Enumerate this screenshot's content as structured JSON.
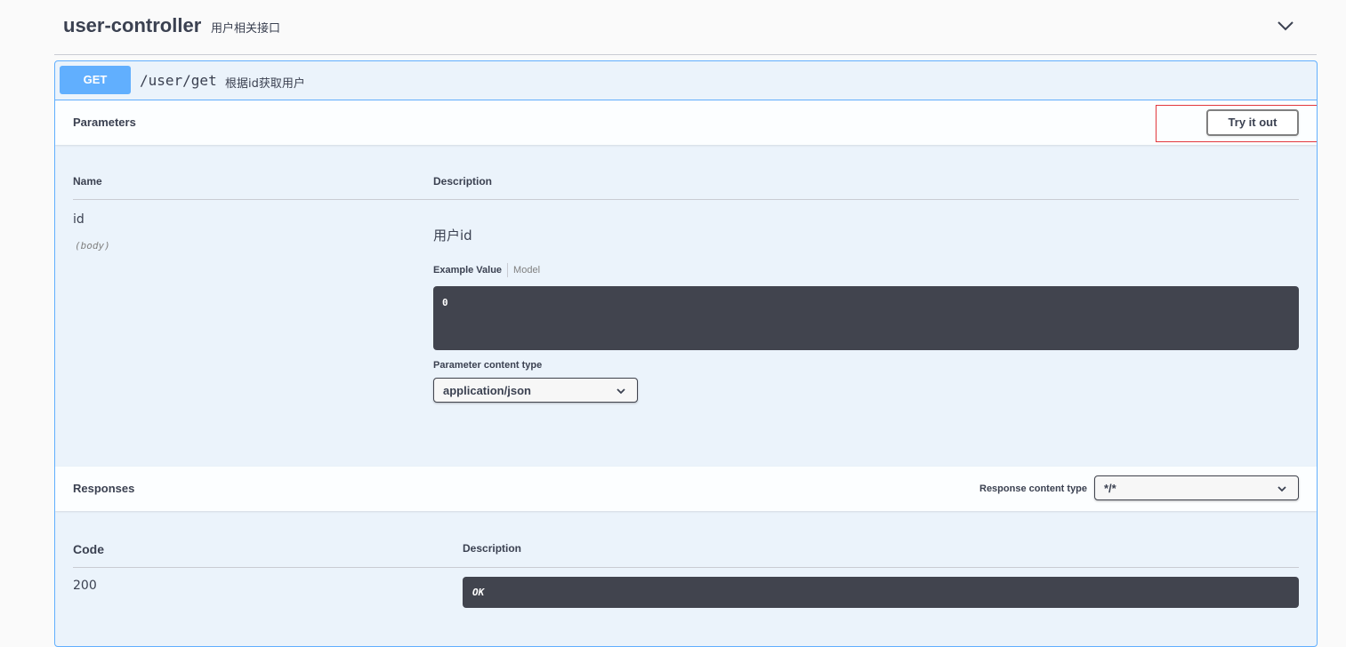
{
  "tag": {
    "name": "user-controller",
    "description": "用户相关接口",
    "chevron_icon": "chevron-down-icon"
  },
  "operation": {
    "method": "GET",
    "path": "/user/get",
    "summary": "根据id获取用户",
    "color": "#61affe"
  },
  "parameters": {
    "title": "Parameters",
    "try_label": "Try it out",
    "columns": {
      "name": "Name",
      "description": "Description"
    },
    "items": [
      {
        "name": "id",
        "in": "(body)",
        "description": "用户id",
        "tabs": {
          "active": "Example Value",
          "inactive": "Model"
        },
        "example": "0"
      }
    ],
    "content_type_label": "Parameter content type",
    "content_type_value": "application/json"
  },
  "responses": {
    "title": "Responses",
    "content_type_label": "Response content type",
    "content_type_value": "*/*",
    "columns": {
      "code": "Code",
      "description": "Description"
    },
    "items": [
      {
        "code": "200",
        "description": "OK"
      }
    ]
  }
}
